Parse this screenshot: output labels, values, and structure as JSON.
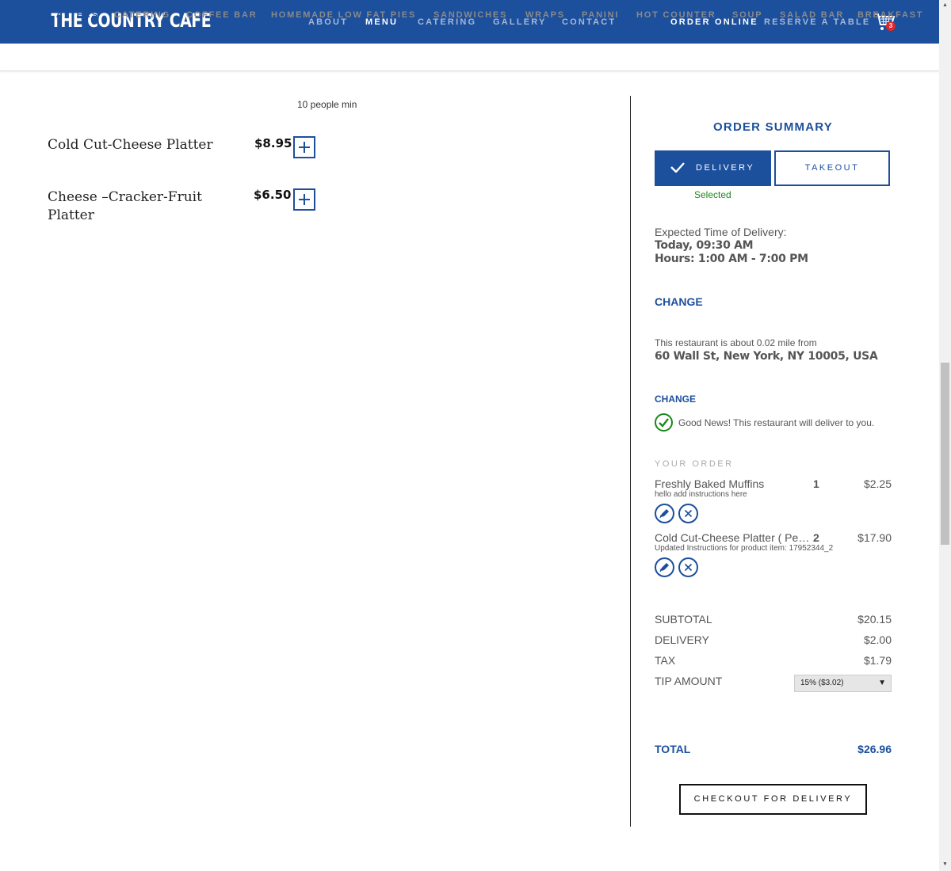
{
  "header": {
    "logo": "THE COUNTRY CAFE",
    "nav": [
      "ABOUT",
      "MENU",
      "CATERING",
      "GALLERY",
      "CONTACT"
    ],
    "order_online": "ORDER ONLINE",
    "reserve": "RESERVE A TABLE",
    "cart_count": "3",
    "cart_icon": "shopping-cart-icon"
  },
  "categories": [
    "PARTY PLATTERS",
    "CATERING",
    "COFFEE BAR",
    "HOMEMADE LOW FAT PIES",
    "SANDWICHES",
    "WRAPS",
    "PANINI",
    "HOT COUNTER",
    "SOUP",
    "SALAD BAR",
    "BREAKFAST"
  ],
  "menu": {
    "min_note": "10 people min",
    "items": [
      {
        "name": "Cold Cut-Cheese Platter",
        "price": "$8.95"
      },
      {
        "name": "Cheese –Cracker-Fruit Platter",
        "price": "$6.50"
      }
    ]
  },
  "summary": {
    "title": "ORDER SUMMARY",
    "delivery_tab": "DELIVERY",
    "takeout_tab": "TAKEOUT",
    "selected": "Selected",
    "expected_label": "Expected Time of Delivery:",
    "expected_time": "Today, 09:30 AM",
    "hours": "Hours: 1:00 AM - 7:00 PM",
    "change_1": "CHANGE",
    "distance_text": "This restaurant is about 0.02 mile from",
    "address": "60 Wall St, New York, NY 10005, USA",
    "change_2": "CHANGE",
    "good_news": "Good News! This restaurant will deliver to you.",
    "your_order": "YOUR ORDER",
    "order_items": [
      {
        "name": "Freshly Baked Muffins",
        "note": "hello add instructions here",
        "qty": "1",
        "price": "$2.25"
      },
      {
        "name": "Cold Cut-Cheese Platter ( Per Person)",
        "note": "Updated Instructions for product item: 17952344_2",
        "qty": "2",
        "price": "$17.90"
      }
    ],
    "subtotal_label": "SUBTOTAL",
    "subtotal": "$20.15",
    "delivery_label": "DELIVERY",
    "delivery": "$2.00",
    "tax_label": "TAX",
    "tax": "$1.79",
    "tip_label": "TIP AMOUNT",
    "tip": "15% ($3.02)",
    "total_label": "TOTAL",
    "total": "$26.96",
    "checkout": "CHECKOUT FOR DELIVERY"
  },
  "colors": {
    "brand": "#1c4f9c",
    "success": "#1a8a1a",
    "badge": "#e0262a"
  }
}
